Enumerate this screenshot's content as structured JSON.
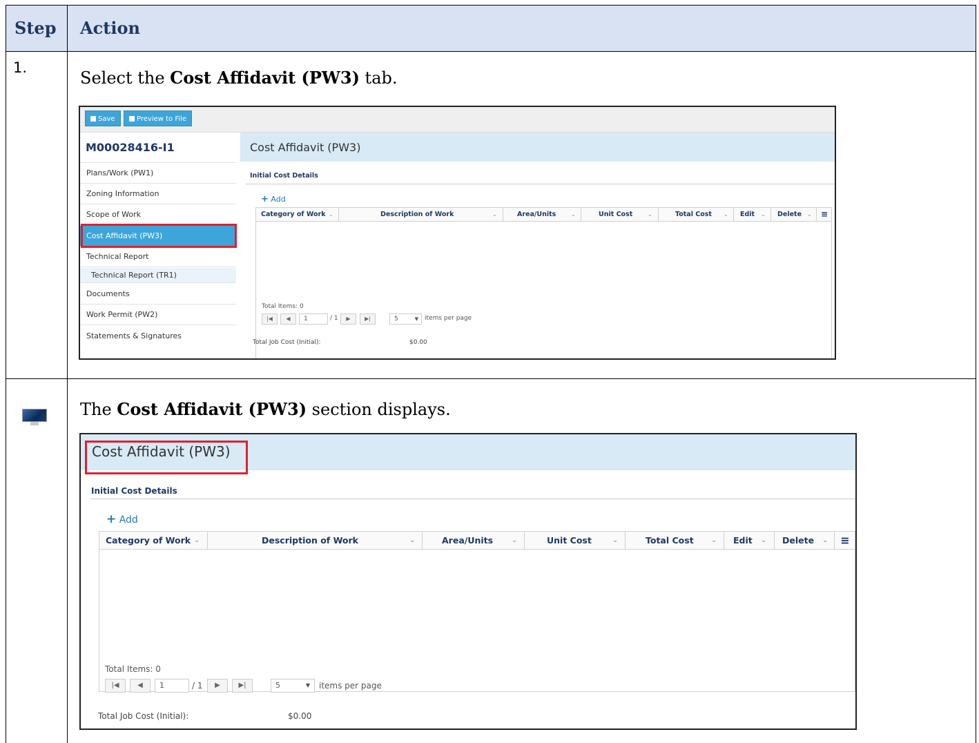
{
  "table": {
    "col_step": "Step",
    "col_action": "Action"
  },
  "step1": {
    "number": "1.",
    "text_before": "Select the ",
    "text_bold": "Cost Affidavit (PW3)",
    "text_after": " tab."
  },
  "step2": {
    "icon": "monitor-icon",
    "text_before": "The ",
    "text_bold": "Cost Affidavit (PW3)",
    "text_after": " section displays."
  },
  "app": {
    "toolbar": {
      "save_label": "Save",
      "preview_label": "Preview to File"
    },
    "job_number": "M00028416-I1",
    "nav": [
      {
        "label": "Plans/Work (PW1)"
      },
      {
        "label": "Zoning Information"
      },
      {
        "label": "Scope of Work"
      },
      {
        "label": "Cost Affidavit (PW3)",
        "active": true
      },
      {
        "label": "Technical Report"
      },
      {
        "label": "Technical Report (TR1)",
        "sub": true
      },
      {
        "label": "Documents"
      },
      {
        "label": "Work Permit (PW2)"
      },
      {
        "label": "Statements & Signatures"
      }
    ],
    "section_title": "Cost Affidavit (PW3)",
    "subsection_title": "Initial Cost Details",
    "add_label": "Add",
    "columns": [
      "Category of Work",
      "Description of Work",
      "Area/Units",
      "Unit Cost",
      "Total Cost",
      "Edit",
      "Delete"
    ],
    "column_menu_icon": "hamburger-icon",
    "total_items": "Total Items: 0",
    "pager": {
      "page": "1",
      "of_pages": "/ 1",
      "per_page": "5",
      "per_page_label": "items per page"
    },
    "total_job_cost_label": "Total Job Cost (Initial):",
    "total_job_cost_value": "$0.00"
  },
  "colors": {
    "accent": "#3da5d9",
    "highlight": "#e0202e",
    "header_band": "#d9e2f3",
    "section_band": "#d8eaf5"
  }
}
